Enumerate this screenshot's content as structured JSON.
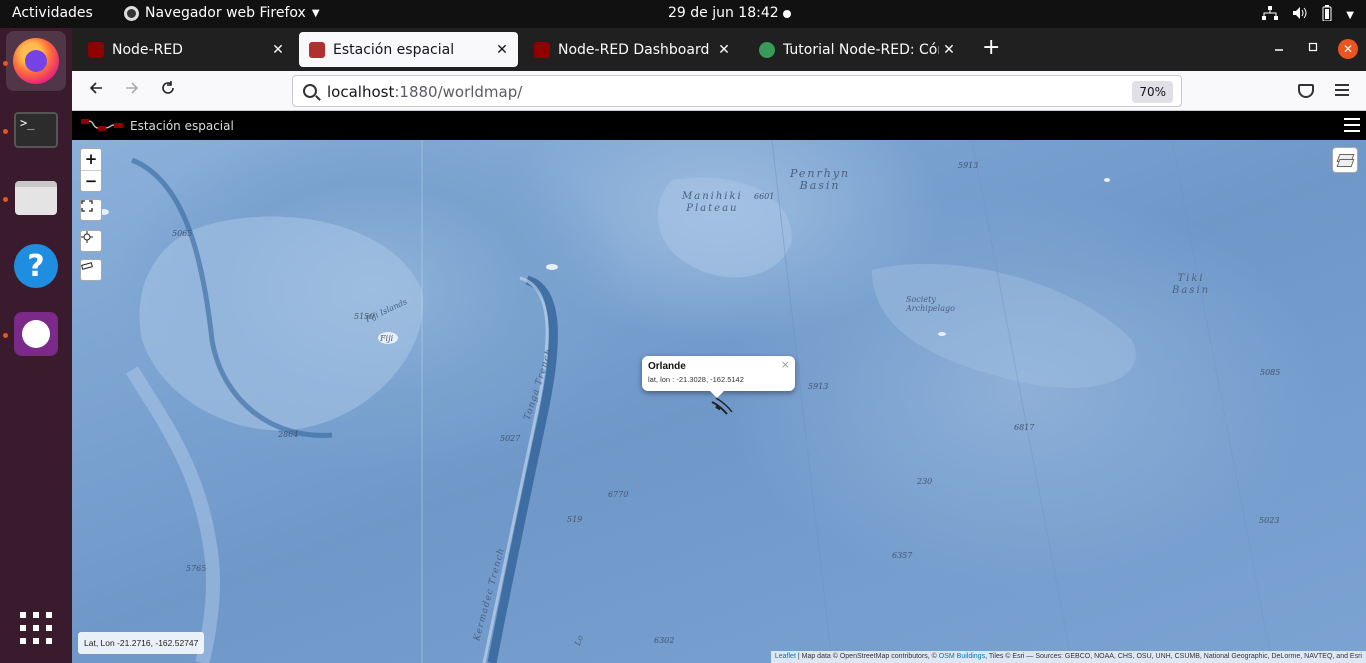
{
  "topbar": {
    "activities": "Actividades",
    "app_name": "Navegador web Firefox",
    "clock": "29 de jun  18:42"
  },
  "dock": {
    "items": [
      {
        "name": "Firefox",
        "icon": "firefox-icon"
      },
      {
        "name": "Terminal",
        "icon": "terminal-icon",
        "glyph": ">_"
      },
      {
        "name": "Files",
        "icon": "files-icon"
      },
      {
        "name": "Help",
        "icon": "help-icon",
        "glyph": "?"
      },
      {
        "name": "GitHub",
        "icon": "github-icon"
      }
    ]
  },
  "browser": {
    "tabs": [
      {
        "label": "Node-RED",
        "selected": false
      },
      {
        "label": "Estación espacial",
        "selected": true
      },
      {
        "label": "Node-RED Dashboard",
        "selected": false
      },
      {
        "label": "Tutorial Node-RED: Cómo",
        "selected": false
      }
    ],
    "close_glyph": "✕",
    "new_tab_glyph": "+",
    "url_host": "localhost",
    "url_path": ":1880/worldmap/",
    "zoom": "70%"
  },
  "page": {
    "title": "Estación espacial",
    "map": {
      "zoom_in": "+",
      "zoom_out": "−",
      "labels": {
        "penrhyn": "Penrhyn\nBasin",
        "manihiki": "Manihiki\nPlateau",
        "tiki": "Tiki\nBasin",
        "society": "Society\nArchipelago",
        "fiji_islands": "Fiji Islands",
        "fiji": "Fiji",
        "tonga": "Tonga Trench",
        "kermadec": "Kermadec Trench",
        "lo": "Lo"
      },
      "depths": [
        "5913",
        "6601",
        "5065",
        "5150",
        "5913",
        "5085",
        "6817",
        "2864",
        "5027",
        "230",
        "6770",
        "519",
        "5023",
        "6357",
        "5765",
        "6302"
      ],
      "popup": {
        "name": "Orlande",
        "coords": "lat, lon : -21.3028, -162.5142",
        "close": "×"
      },
      "coordinates": "Lat, Lon   -21.2716, -162.52747",
      "attribution_link": "Leaflet",
      "attribution_mid": " | Map data © OpenStreetMap contributors, © ",
      "attribution_link2": "OSM Buildings",
      "attribution_end": ", Tiles © Esri — Sources: GEBCO, NOAA, CHS, OSU, UNH, CSUMB, National Geographic, DeLorme, NAVTEQ, and Esri"
    }
  },
  "colors": {
    "ubuntu_orange": "#e95420",
    "ocean": "#7ca3d2",
    "topbar": "#111111"
  }
}
